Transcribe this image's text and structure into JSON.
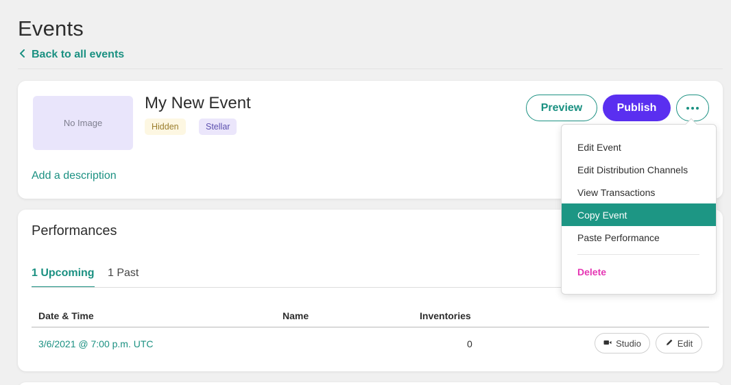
{
  "header": {
    "title": "Events",
    "back_link": "Back to all events"
  },
  "event": {
    "image_placeholder": "No Image",
    "name": "My New Event",
    "badges": [
      "Hidden",
      "Stellar"
    ],
    "add_description": "Add a description",
    "preview_label": "Preview",
    "publish_label": "Publish"
  },
  "colors": {
    "accent": "#1a9081",
    "publish": "#5a2ff0",
    "delete": "#e535b3",
    "menu_highlight": "#1d9684"
  },
  "performances": {
    "title": "Performances",
    "tabs": [
      {
        "label": "1 Upcoming",
        "active": true
      },
      {
        "label": "1 Past",
        "active": false
      }
    ],
    "columns": [
      "Date & Time",
      "Name",
      "Inventories"
    ],
    "rows": [
      {
        "date_time": "3/6/2021 @ 7:00 p.m. UTC",
        "name": "",
        "inventories": "0",
        "studio_label": "Studio",
        "edit_label": "Edit"
      }
    ]
  },
  "menu": {
    "items": [
      {
        "label": "Edit Event",
        "highlighted": false
      },
      {
        "label": "Edit Distribution Channels",
        "highlighted": false
      },
      {
        "label": "View Transactions",
        "highlighted": false
      },
      {
        "label": "Copy Event",
        "highlighted": true
      },
      {
        "label": "Paste Performance",
        "highlighted": false
      }
    ],
    "delete_label": "Delete"
  },
  "icons": {
    "back": "chevron-left-icon",
    "more": "more-horizontal-icon",
    "studio": "video-camera-icon",
    "edit": "pencil-icon"
  }
}
